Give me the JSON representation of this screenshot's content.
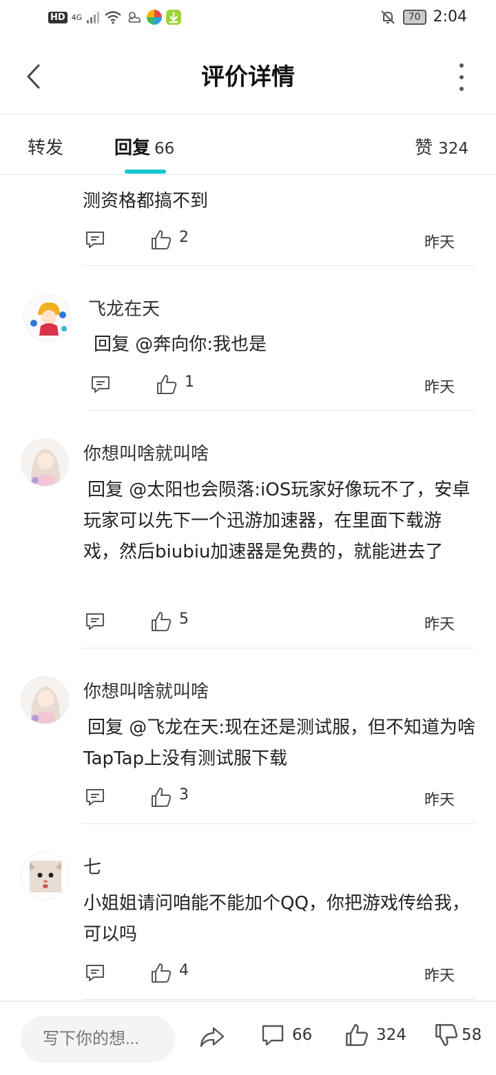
{
  "status_bar": {
    "hd": "HD",
    "network": "4G",
    "battery": "70",
    "time": "2:04"
  },
  "header": {
    "title": "评价详情"
  },
  "tabs": {
    "forward": "转发",
    "reply_label": "回复",
    "reply_count": "66",
    "like_label": "赞",
    "like_count": "324"
  },
  "comments": [
    {
      "author": "",
      "text": "测资格都搞不到",
      "likes": "2",
      "time": "昨天"
    },
    {
      "author": "飞龙在天",
      "text": "回复 @奔向你:我也是",
      "likes": "1",
      "time": "昨天"
    },
    {
      "author": "你想叫啥就叫啥",
      "text": "回复 @太阳也会陨落:iOS玩家好像玩不了，安卓玩家可以先下一个迅游加速器，在里面下载游戏，然后biubiu加速器是免费的，就能进去了",
      "likes": "5",
      "time": "昨天"
    },
    {
      "author": "你想叫啥就叫啥",
      "text": "回复 @飞龙在天:现在还是测试服，但不知道为啥TapTap上没有测试服下载",
      "likes": "3",
      "time": "昨天"
    },
    {
      "author": "七",
      "text": "小姐姐请问咱能不能加个QQ，你把游戏传给我，可以吗",
      "likes": "4",
      "time": "昨天"
    }
  ],
  "bottom_bar": {
    "input_placeholder": "写下你的想...",
    "comment_count": "66",
    "like_count": "324",
    "dislike_count": "58"
  },
  "colors": {
    "accent": "#15c5ce",
    "divider": "#e6e6e6",
    "icon": "#555555"
  }
}
